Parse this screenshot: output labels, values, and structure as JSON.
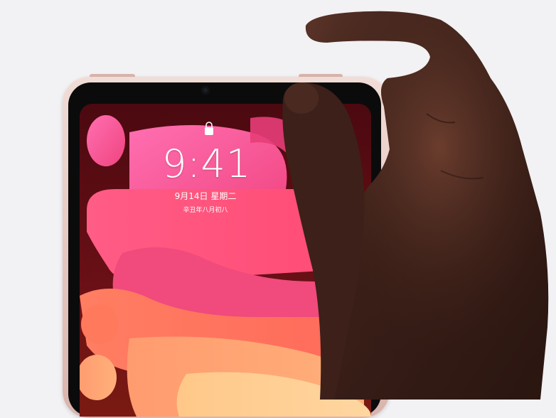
{
  "device": {
    "name": "tablet",
    "frame_color": "#e6c8c1",
    "wallpaper_accent_colors": [
      "#f7418b",
      "#ff7a59",
      "#ff9a66",
      "#ffd0a0"
    ]
  },
  "lock_screen": {
    "lock_icon": "lock-icon",
    "time": "9:41",
    "date": "9月14日 星期二",
    "lunar_date": "辛丑年八月初八"
  }
}
